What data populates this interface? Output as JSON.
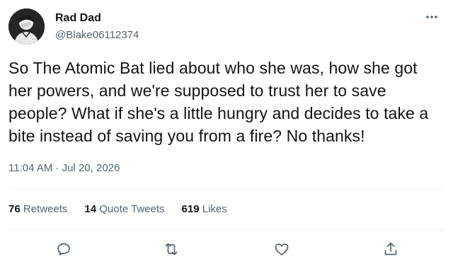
{
  "user": {
    "display_name": "Rad Dad",
    "handle": "@Blake06112374",
    "avatar_icon": "avatar-person-facepalm"
  },
  "tweet": {
    "text": "So The Atomic Bat lied about who she was, how she got her powers, and we're supposed to trust her to save people? What if she's a little hungry and decides to take a bite instead of saving you from a fire? No thanks!",
    "time": "11:04 AM",
    "separator": "·",
    "date": "Jul 20, 2026"
  },
  "stats": {
    "retweets": {
      "count": "76",
      "label": "Retweets"
    },
    "quote_tweets": {
      "count": "14",
      "label": "Quote Tweets"
    },
    "likes": {
      "count": "619",
      "label": "Likes"
    }
  },
  "actions": {
    "icons": [
      "reply-icon",
      "retweet-icon",
      "like-icon",
      "share-icon"
    ]
  },
  "colors": {
    "text": "#0f1419",
    "secondary": "#536471",
    "divider": "#eff3f4"
  }
}
